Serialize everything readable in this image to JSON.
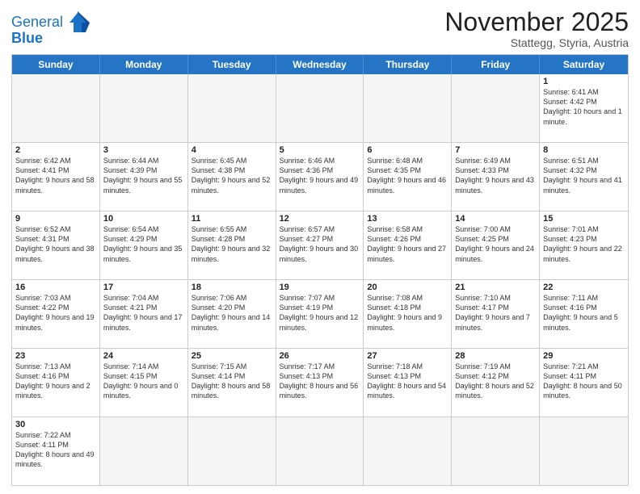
{
  "header": {
    "logo_general": "General",
    "logo_blue": "Blue",
    "title": "November 2025",
    "subtitle": "Stattegg, Styria, Austria"
  },
  "days_of_week": [
    "Sunday",
    "Monday",
    "Tuesday",
    "Wednesday",
    "Thursday",
    "Friday",
    "Saturday"
  ],
  "weeks": [
    [
      {
        "day": "",
        "info": ""
      },
      {
        "day": "",
        "info": ""
      },
      {
        "day": "",
        "info": ""
      },
      {
        "day": "",
        "info": ""
      },
      {
        "day": "",
        "info": ""
      },
      {
        "day": "",
        "info": ""
      },
      {
        "day": "1",
        "info": "Sunrise: 6:41 AM\nSunset: 4:42 PM\nDaylight: 10 hours\nand 1 minute."
      }
    ],
    [
      {
        "day": "2",
        "info": "Sunrise: 6:42 AM\nSunset: 4:41 PM\nDaylight: 9 hours\nand 58 minutes."
      },
      {
        "day": "3",
        "info": "Sunrise: 6:44 AM\nSunset: 4:39 PM\nDaylight: 9 hours\nand 55 minutes."
      },
      {
        "day": "4",
        "info": "Sunrise: 6:45 AM\nSunset: 4:38 PM\nDaylight: 9 hours\nand 52 minutes."
      },
      {
        "day": "5",
        "info": "Sunrise: 6:46 AM\nSunset: 4:36 PM\nDaylight: 9 hours\nand 49 minutes."
      },
      {
        "day": "6",
        "info": "Sunrise: 6:48 AM\nSunset: 4:35 PM\nDaylight: 9 hours\nand 46 minutes."
      },
      {
        "day": "7",
        "info": "Sunrise: 6:49 AM\nSunset: 4:33 PM\nDaylight: 9 hours\nand 43 minutes."
      },
      {
        "day": "8",
        "info": "Sunrise: 6:51 AM\nSunset: 4:32 PM\nDaylight: 9 hours\nand 41 minutes."
      }
    ],
    [
      {
        "day": "9",
        "info": "Sunrise: 6:52 AM\nSunset: 4:31 PM\nDaylight: 9 hours\nand 38 minutes."
      },
      {
        "day": "10",
        "info": "Sunrise: 6:54 AM\nSunset: 4:29 PM\nDaylight: 9 hours\nand 35 minutes."
      },
      {
        "day": "11",
        "info": "Sunrise: 6:55 AM\nSunset: 4:28 PM\nDaylight: 9 hours\nand 32 minutes."
      },
      {
        "day": "12",
        "info": "Sunrise: 6:57 AM\nSunset: 4:27 PM\nDaylight: 9 hours\nand 30 minutes."
      },
      {
        "day": "13",
        "info": "Sunrise: 6:58 AM\nSunset: 4:26 PM\nDaylight: 9 hours\nand 27 minutes."
      },
      {
        "day": "14",
        "info": "Sunrise: 7:00 AM\nSunset: 4:25 PM\nDaylight: 9 hours\nand 24 minutes."
      },
      {
        "day": "15",
        "info": "Sunrise: 7:01 AM\nSunset: 4:23 PM\nDaylight: 9 hours\nand 22 minutes."
      }
    ],
    [
      {
        "day": "16",
        "info": "Sunrise: 7:03 AM\nSunset: 4:22 PM\nDaylight: 9 hours\nand 19 minutes."
      },
      {
        "day": "17",
        "info": "Sunrise: 7:04 AM\nSunset: 4:21 PM\nDaylight: 9 hours\nand 17 minutes."
      },
      {
        "day": "18",
        "info": "Sunrise: 7:06 AM\nSunset: 4:20 PM\nDaylight: 9 hours\nand 14 minutes."
      },
      {
        "day": "19",
        "info": "Sunrise: 7:07 AM\nSunset: 4:19 PM\nDaylight: 9 hours\nand 12 minutes."
      },
      {
        "day": "20",
        "info": "Sunrise: 7:08 AM\nSunset: 4:18 PM\nDaylight: 9 hours\nand 9 minutes."
      },
      {
        "day": "21",
        "info": "Sunrise: 7:10 AM\nSunset: 4:17 PM\nDaylight: 9 hours\nand 7 minutes."
      },
      {
        "day": "22",
        "info": "Sunrise: 7:11 AM\nSunset: 4:16 PM\nDaylight: 9 hours\nand 5 minutes."
      }
    ],
    [
      {
        "day": "23",
        "info": "Sunrise: 7:13 AM\nSunset: 4:16 PM\nDaylight: 9 hours\nand 2 minutes."
      },
      {
        "day": "24",
        "info": "Sunrise: 7:14 AM\nSunset: 4:15 PM\nDaylight: 9 hours\nand 0 minutes."
      },
      {
        "day": "25",
        "info": "Sunrise: 7:15 AM\nSunset: 4:14 PM\nDaylight: 8 hours\nand 58 minutes."
      },
      {
        "day": "26",
        "info": "Sunrise: 7:17 AM\nSunset: 4:13 PM\nDaylight: 8 hours\nand 56 minutes."
      },
      {
        "day": "27",
        "info": "Sunrise: 7:18 AM\nSunset: 4:13 PM\nDaylight: 8 hours\nand 54 minutes."
      },
      {
        "day": "28",
        "info": "Sunrise: 7:19 AM\nSunset: 4:12 PM\nDaylight: 8 hours\nand 52 minutes."
      },
      {
        "day": "29",
        "info": "Sunrise: 7:21 AM\nSunset: 4:11 PM\nDaylight: 8 hours\nand 50 minutes."
      }
    ],
    [
      {
        "day": "30",
        "info": "Sunrise: 7:22 AM\nSunset: 4:11 PM\nDaylight: 8 hours\nand 49 minutes."
      },
      {
        "day": "",
        "info": ""
      },
      {
        "day": "",
        "info": ""
      },
      {
        "day": "",
        "info": ""
      },
      {
        "day": "",
        "info": ""
      },
      {
        "day": "",
        "info": ""
      },
      {
        "day": "",
        "info": ""
      }
    ]
  ]
}
